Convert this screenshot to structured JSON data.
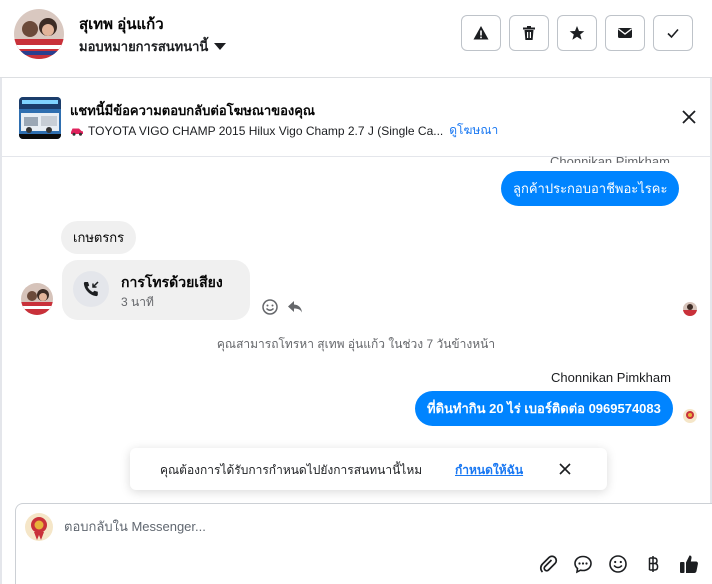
{
  "header": {
    "contact_name": "สุเทพ อุ่นแก้ว",
    "assign_label": "มอบหมายการสนทนานี้"
  },
  "ad": {
    "title": "แชทนี้มีข้อความตอบกลับต่อโฆษณาของคุณ",
    "vehicle": "TOYOTA VIGO CHAMP 2015 Hilux Vigo Champ 2.7 J (Single Ca...",
    "link": "ดูโฆษณา"
  },
  "messages": {
    "top_sender": "Chonnikan Pimkham",
    "out_1": "ลูกค้าประกอบอาชีพอะไรคะ",
    "in_1": "เกษตรกร",
    "call_title": "การโทรด้วยเสียง",
    "call_duration": "3 นาที",
    "system_note": "คุณสามารถโทรหา สุเทพ อุ่นแก้ว ในช่วง 7 วันข้างหน้า",
    "sender_name": "Chonnikan Pimkham",
    "out_2": "ที่ดินทำกิน 20 ไร่ เบอร์ติดต่อ 0969574083"
  },
  "toast": {
    "text": "คุณต้องการได้รับการกำหนดไปยังการสนทนานี้ไหม",
    "link": "กำหนดให้ฉัน"
  },
  "composer": {
    "placeholder": "ตอบกลับใน Messenger..."
  },
  "colors": {
    "accent": "#0084ff",
    "link": "#1877f2"
  }
}
